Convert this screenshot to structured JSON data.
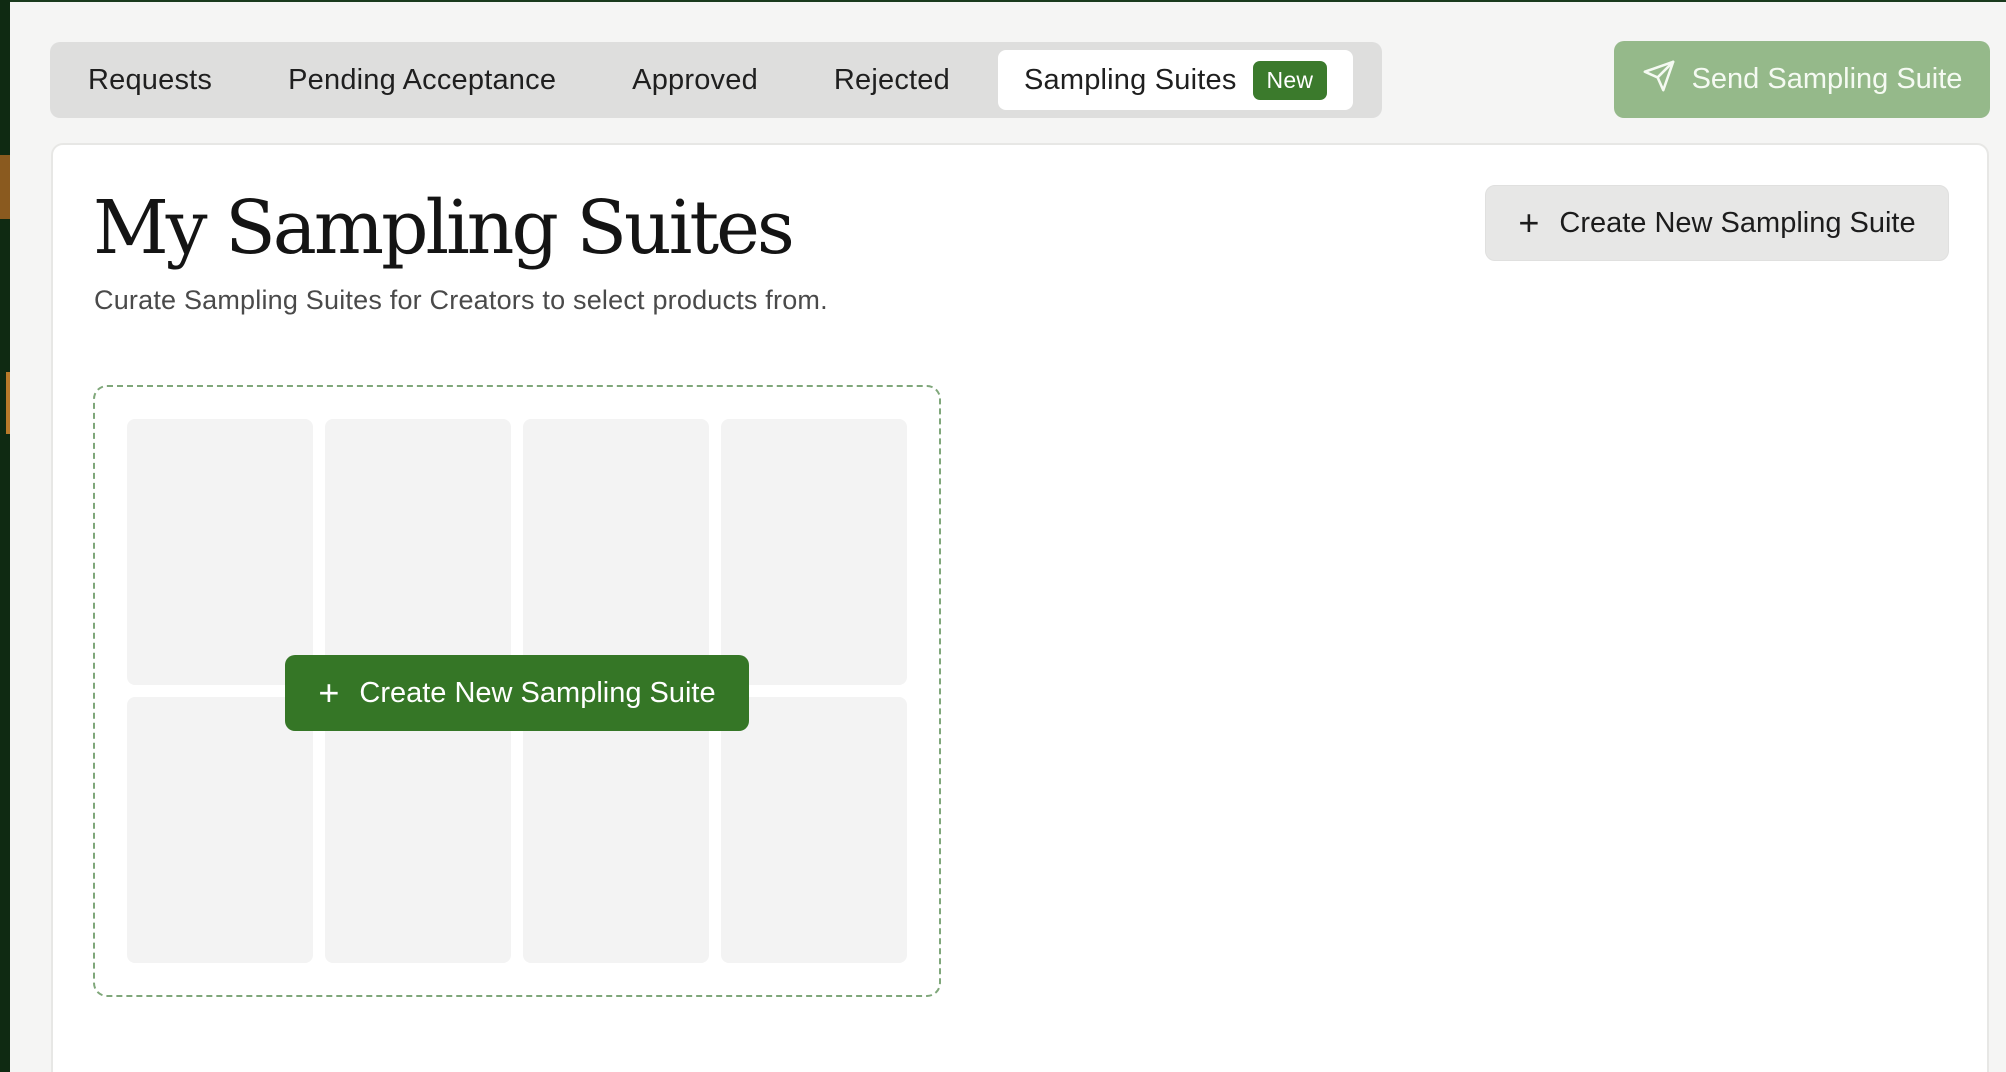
{
  "tabs": [
    {
      "label": "Requests"
    },
    {
      "label": "Pending Acceptance"
    },
    {
      "label": "Approved"
    },
    {
      "label": "Rejected"
    },
    {
      "label": "Sampling Suites",
      "badge": "New",
      "active": true
    }
  ],
  "header": {
    "send_button_label": "Send Sampling Suite",
    "send_button_icon": "send-icon"
  },
  "page": {
    "title": "My Sampling Suites",
    "subtitle": "Curate Sampling Suites for Creators to select products from.",
    "create_top_label": "Create New Sampling Suite",
    "create_center_label": "Create New Sampling Suite",
    "plus_icon": "+"
  },
  "colors": {
    "brand_green": "#357626",
    "badge_green": "#3b7a2c",
    "send_disabled": "#95b98a",
    "dashed_border": "#7fa77a"
  }
}
